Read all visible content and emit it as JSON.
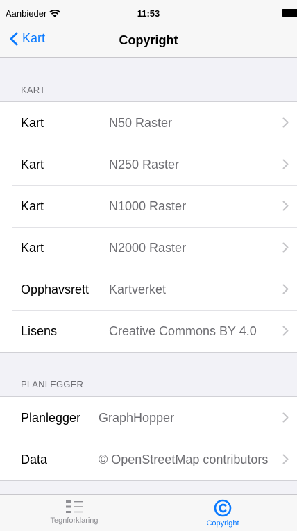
{
  "status": {
    "carrier": "Aanbieder",
    "time": "11:53"
  },
  "nav": {
    "back_label": "Kart",
    "title": "Copyright"
  },
  "sections": [
    {
      "header": "KART",
      "rows": [
        {
          "key": "Kart",
          "value": "N50 Raster"
        },
        {
          "key": "Kart",
          "value": "N250 Raster"
        },
        {
          "key": "Kart",
          "value": "N1000 Raster"
        },
        {
          "key": "Kart",
          "value": "N2000 Raster"
        },
        {
          "key": "Opphavsrett",
          "value": "Kartverket"
        },
        {
          "key": "Lisens",
          "value": "Creative Commons BY 4.0"
        }
      ]
    },
    {
      "header": "PLANLEGGER",
      "rows": [
        {
          "key": "Planlegger",
          "value": "GraphHopper"
        },
        {
          "key": "Data",
          "value": "© OpenStreetMap contributors"
        }
      ]
    }
  ],
  "tabs": [
    {
      "label": "Tegnforklaring",
      "icon": "list-icon",
      "active": false
    },
    {
      "label": "Copyright",
      "icon": "copyright-icon",
      "active": true
    }
  ],
  "colors": {
    "accent": "#0a7aff",
    "inactive": "#8e8e93",
    "secondary_text": "#6d6d72"
  }
}
